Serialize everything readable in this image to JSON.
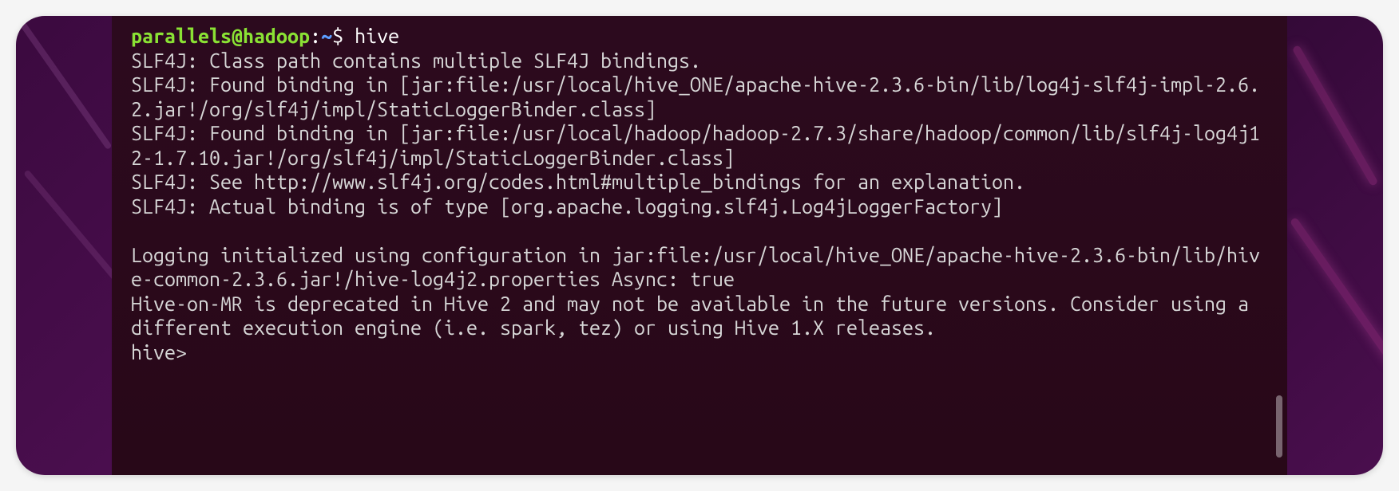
{
  "prompt": {
    "user": "parallels",
    "at": "@",
    "host": "hadoop",
    "colon": ":",
    "path": "~",
    "dollar": "$",
    "command": "hive"
  },
  "output": {
    "lines": [
      "SLF4J: Class path contains multiple SLF4J bindings.",
      "SLF4J: Found binding in [jar:file:/usr/local/hive_ONE/apache-hive-2.3.6-bin/lib/log4j-slf4j-impl-2.6.2.jar!/org/slf4j/impl/StaticLoggerBinder.class]",
      "SLF4J: Found binding in [jar:file:/usr/local/hadoop/hadoop-2.7.3/share/hadoop/common/lib/slf4j-log4j12-1.7.10.jar!/org/slf4j/impl/StaticLoggerBinder.class]",
      "SLF4J: See http://www.slf4j.org/codes.html#multiple_bindings for an explanation.",
      "SLF4J: Actual binding is of type [org.apache.logging.slf4j.Log4jLoggerFactory]",
      "",
      "Logging initialized using configuration in jar:file:/usr/local/hive_ONE/apache-hive-2.3.6-bin/lib/hive-common-2.3.6.jar!/hive-log4j2.properties Async: true",
      "Hive-on-MR is deprecated in Hive 2 and may not be available in the future versions. Consider using a different execution engine (i.e. spark, tez) or using Hive 1.X releases."
    ],
    "hive_prompt": "hive> "
  }
}
